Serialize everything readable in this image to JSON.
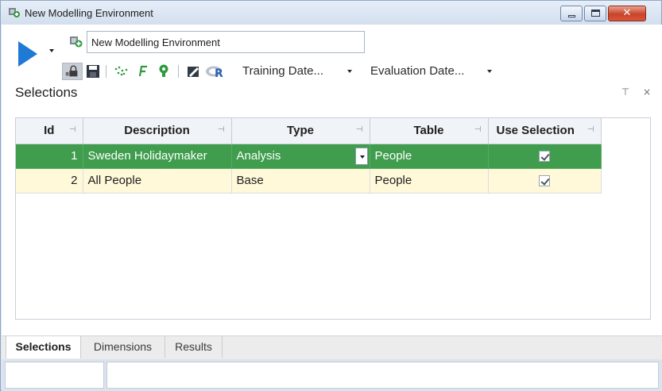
{
  "window": {
    "title": "New Modelling Environment",
    "minimize_label": "",
    "maximize_label": "",
    "close_label": "✕"
  },
  "toolbar": {
    "environment_name": "New Modelling Environment",
    "training_date_label": "Training Date...",
    "evaluation_date_label": "Evaluation Date...",
    "icons": [
      "run-icon",
      "lock-icon",
      "save-icon",
      "scatter-icon",
      "formula-icon",
      "bulb-icon",
      "pencil-icon",
      "r-icon"
    ]
  },
  "panel": {
    "title": "Selections",
    "pin_glyph": "⊤",
    "close_glyph": "×"
  },
  "grid": {
    "columns": [
      "Id",
      "Description",
      "Type",
      "Table",
      "Use Selection"
    ],
    "rows": [
      {
        "id": "1",
        "description": "Sweden Holidaymaker",
        "type": "Analysis",
        "table": "People",
        "use_selection": true
      },
      {
        "id": "2",
        "description": "All People",
        "type": "Base",
        "table": "People",
        "use_selection": true
      }
    ]
  },
  "tabs": [
    {
      "label": "Selections",
      "active": true
    },
    {
      "label": "Dimensions",
      "active": false
    },
    {
      "label": "Results",
      "active": false
    }
  ],
  "colors": {
    "selected_row": "#3f9d4d",
    "alt_row": "#fff9da",
    "run_button": "#1f7ad6"
  }
}
